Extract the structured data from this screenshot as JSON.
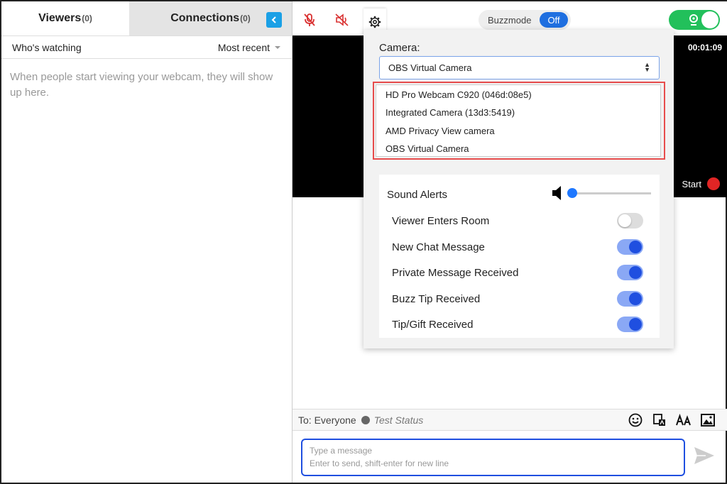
{
  "tabs": [
    {
      "label": "Viewers",
      "count": "(0)"
    },
    {
      "label": "Connections",
      "count": "(0)"
    }
  ],
  "viewers": {
    "filter_label": "Who's watching",
    "sort_label": "Most recent",
    "empty_message": "When people start viewing your webcam, they will show up here."
  },
  "toolbar": {
    "buzzmode_label": "Buzzmode",
    "buzzmode_state": "Off",
    "accent_color": "#1f6fe0",
    "live_color": "#22c05b",
    "icons": [
      "chevron-left-icon",
      "mic-muted-icon",
      "speaker-muted-icon",
      "gear-icon",
      "webcam-icon"
    ]
  },
  "video": {
    "timer": "00:01:09",
    "start_label": "Start"
  },
  "settings": {
    "camera_label": "Camera:",
    "camera_selected": "OBS Virtual Camera",
    "camera_options": [
      "HD Pro Webcam C920 (046d:08e5)",
      "Integrated Camera (13d3:5419)",
      "AMD Privacy View camera",
      "OBS Virtual Camera"
    ],
    "sound_alerts_label": "Sound Alerts",
    "volume_level": 0.02,
    "alerts": [
      {
        "label": "Viewer Enters Room",
        "enabled": false
      },
      {
        "label": "New Chat Message",
        "enabled": true
      },
      {
        "label": "Private Message Received",
        "enabled": true
      },
      {
        "label": "Buzz Tip Received",
        "enabled": true
      },
      {
        "label": "Tip/Gift Received",
        "enabled": true
      }
    ]
  },
  "chat": {
    "to_label": "To: Everyone",
    "status_text": "Test Status",
    "input_placeholder_line1": "Type a message",
    "input_placeholder_line2": "Enter to send, shift-enter for new line",
    "tool_icons": [
      "emoji-icon",
      "file-share-icon",
      "text-format-icon",
      "image-icon"
    ]
  }
}
